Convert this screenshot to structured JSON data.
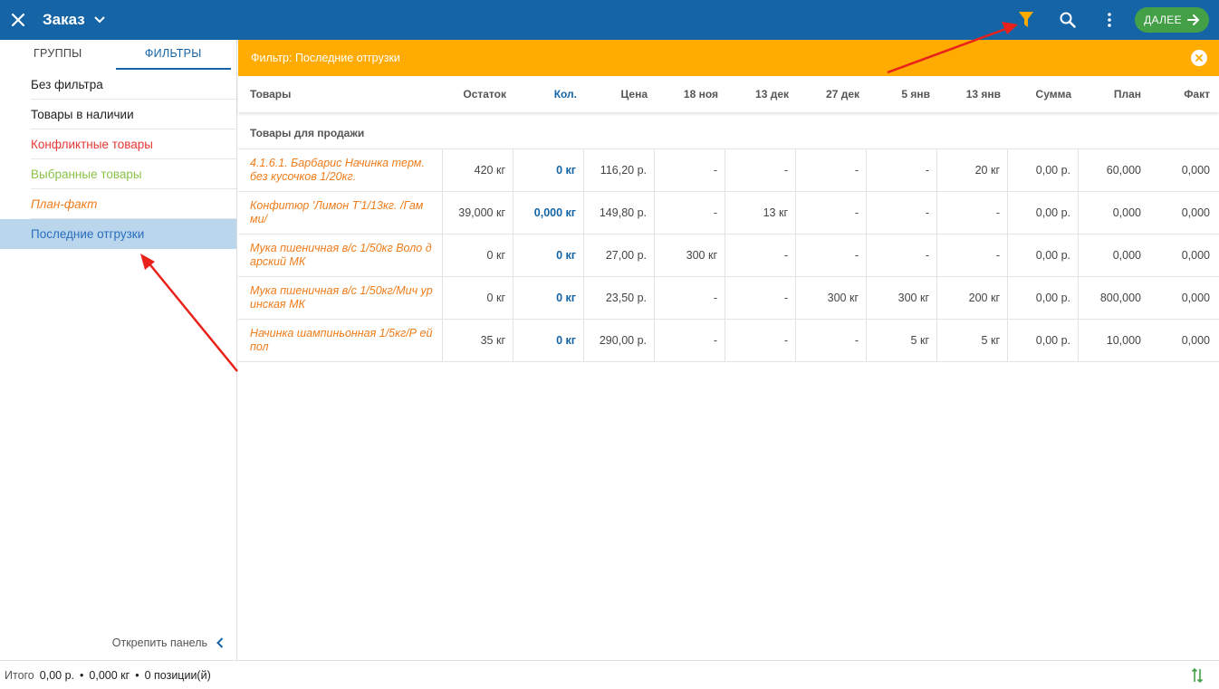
{
  "appbar": {
    "title": "Заказ",
    "next_label": "ДАЛЕЕ",
    "colors": {
      "bar": "#1565a6",
      "filter_icon": "#ffab00",
      "next": "#43a047"
    }
  },
  "side": {
    "tabs": [
      {
        "label": "ГРУППЫ"
      },
      {
        "label": "ФИЛЬТРЫ"
      }
    ],
    "filters": [
      {
        "label": "Без фильтра",
        "color": "#212121",
        "italic": false
      },
      {
        "label": "Товары в наличии",
        "color": "#212121",
        "italic": false
      },
      {
        "label": "Конфликтные товары",
        "color": "#e53935",
        "italic": false
      },
      {
        "label": "Выбранные товары",
        "color": "#8bc34a",
        "italic": false
      },
      {
        "label": "План-факт",
        "color": "#f07c1a",
        "italic": true
      },
      {
        "label": "Последние отгрузки",
        "color": "#2a6ec0",
        "italic": false
      }
    ],
    "unpin_label": "Открепить панель"
  },
  "banner": {
    "text": "Фильтр: Последние отгрузки"
  },
  "table": {
    "headers": [
      "Товары",
      "Остаток",
      "Кол.",
      "Цена",
      "18 ноя",
      "13 дек",
      "27 дек",
      "5 янв",
      "13 янв",
      "Сумма",
      "План",
      "Факт"
    ],
    "group_label": "Товары для продажи",
    "rows": [
      [
        "4.1.6.1. Барбарис Начинка терм. без кусочков 1/20кг.",
        "420 кг",
        "0 кг",
        "116,20 р.",
        "-",
        "-",
        "-",
        "-",
        "20 кг",
        "0,00 р.",
        "60,000",
        "0,000"
      ],
      [
        "Конфитюр 'Лимон Т'1/13кг. /Гам ми/",
        "39,000 кг",
        "0,000 кг",
        "149,80 р.",
        "-",
        "13 кг",
        "-",
        "-",
        "-",
        "0,00 р.",
        "0,000",
        "0,000"
      ],
      [
        "Мука пшеничная в/с 1/50кг Воло дарский МК",
        "0 кг",
        "0 кг",
        "27,00 р.",
        "300 кг",
        "-",
        "-",
        "-",
        "-",
        "0,00 р.",
        "0,000",
        "0,000"
      ],
      [
        "Мука пшеничная в/с 1/50кг/Мич уринская МК",
        "0 кг",
        "0 кг",
        "23,50 р.",
        "-",
        "-",
        "300 кг",
        "300 кг",
        "200 кг",
        "0,00 р.",
        "800,000",
        "0,000"
      ],
      [
        "Начинка шампиньонная 1/5кг/Р ейпол",
        "35 кг",
        "0 кг",
        "290,00 р.",
        "-",
        "-",
        "-",
        "5 кг",
        "5 кг",
        "0,00 р.",
        "10,000",
        "0,000"
      ]
    ]
  },
  "footer": {
    "label": "Итого",
    "sum": "0,00 р.",
    "qty": "0,000 кг",
    "positions": "0 позиции(й)",
    "separator": "•"
  }
}
